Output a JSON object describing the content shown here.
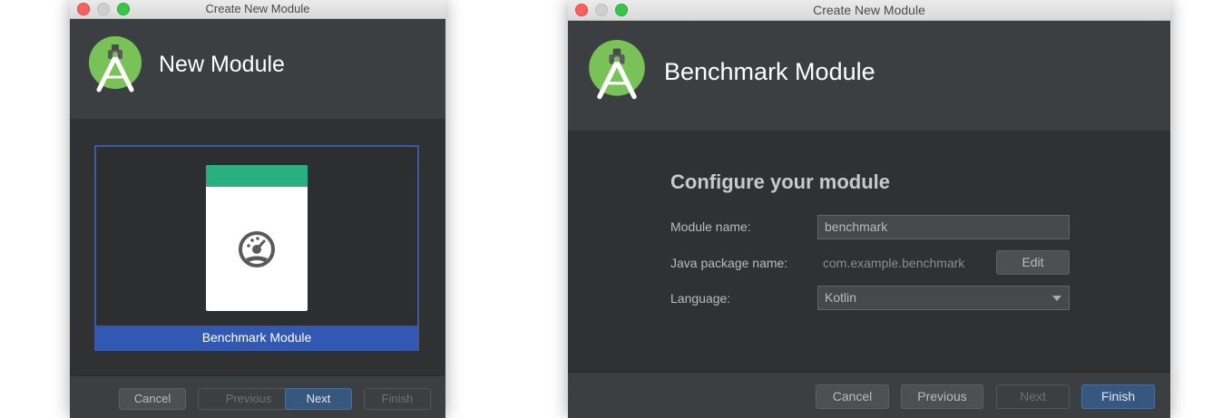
{
  "left_window": {
    "title": "Create New Module",
    "header_title": "New Module",
    "gallery": {
      "selected_label": "Benchmark Module"
    },
    "buttons": {
      "cancel": "Cancel",
      "previous": "Previous",
      "next": "Next",
      "finish": "Finish"
    }
  },
  "right_window": {
    "title": "Create New Module",
    "header_title": "Benchmark Module",
    "section_title": "Configure your module",
    "form": {
      "module_name_label": "Module name:",
      "module_name_value": "benchmark",
      "package_label": "Java package name:",
      "package_value": "com.example.benchmark",
      "edit_label": "Edit",
      "language_label": "Language:",
      "language_value": "Kotlin"
    },
    "buttons": {
      "cancel": "Cancel",
      "previous": "Previous",
      "next": "Next",
      "finish": "Finish"
    }
  },
  "colors": {
    "accent_green": "#2aaf80",
    "selection_blue": "#3159b4",
    "primary_button": "#365880"
  },
  "icons": [
    "android-studio-logo-icon",
    "benchmark-gauge-icon",
    "dropdown-arrow-icon"
  ]
}
